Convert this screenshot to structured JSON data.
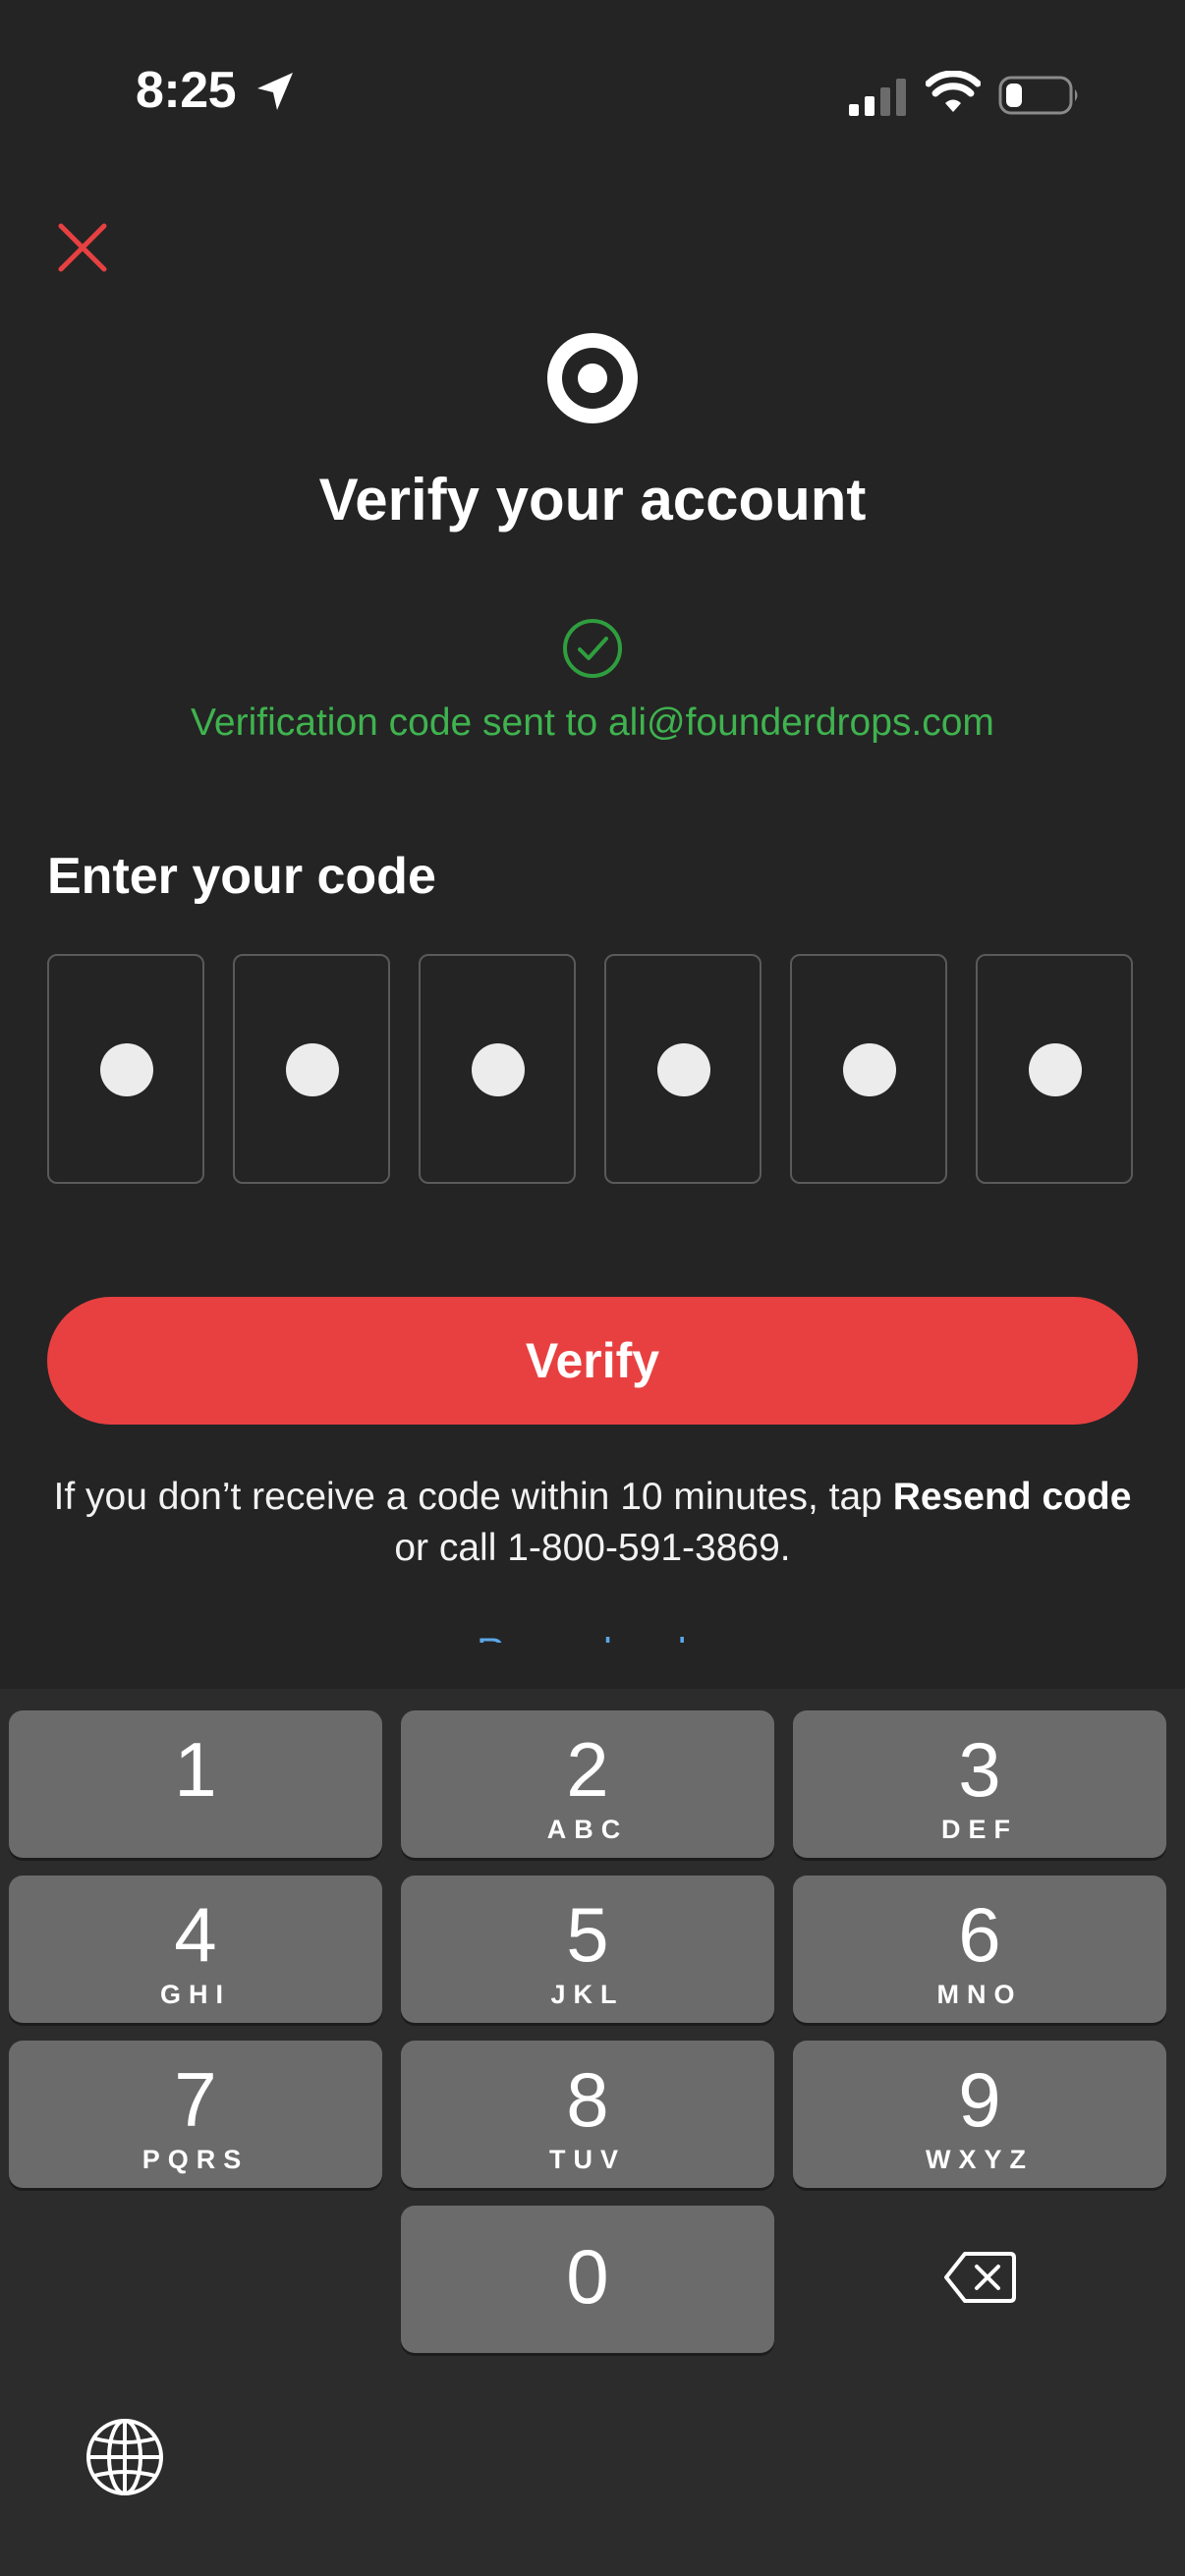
{
  "status_bar": {
    "time": "8:25"
  },
  "header": {
    "title": "Verify your account",
    "sent_message": "Verification code sent to ali@founderdrops.com"
  },
  "code_entry": {
    "label": "Enter your code",
    "digits_entered": 6,
    "mask_char": "●"
  },
  "actions": {
    "verify_label": "Verify",
    "help_prefix": "If you don’t receive a code within 10 minutes, tap ",
    "help_bold": "Resend code",
    "help_suffix": " or call 1-800-591-3869.",
    "resend_label": "Resend code"
  },
  "keyboard": {
    "keys": [
      {
        "digit": "1",
        "letters": ""
      },
      {
        "digit": "2",
        "letters": "ABC"
      },
      {
        "digit": "3",
        "letters": "DEF"
      },
      {
        "digit": "4",
        "letters": "GHI"
      },
      {
        "digit": "5",
        "letters": "JKL"
      },
      {
        "digit": "6",
        "letters": "MNO"
      },
      {
        "digit": "7",
        "letters": "PQRS"
      },
      {
        "digit": "8",
        "letters": "TUV"
      },
      {
        "digit": "9",
        "letters": "WXYZ"
      },
      {
        "digit": "0",
        "letters": ""
      }
    ]
  },
  "colors": {
    "background": "#242424",
    "accent_red": "#e84041",
    "success_green": "#3fb34f",
    "link_blue": "#5aa7e8"
  },
  "icons": {
    "close": "close-icon",
    "logo": "target-logo",
    "success": "check-circle-icon",
    "backspace": "backspace-icon",
    "globe": "globe-icon"
  }
}
